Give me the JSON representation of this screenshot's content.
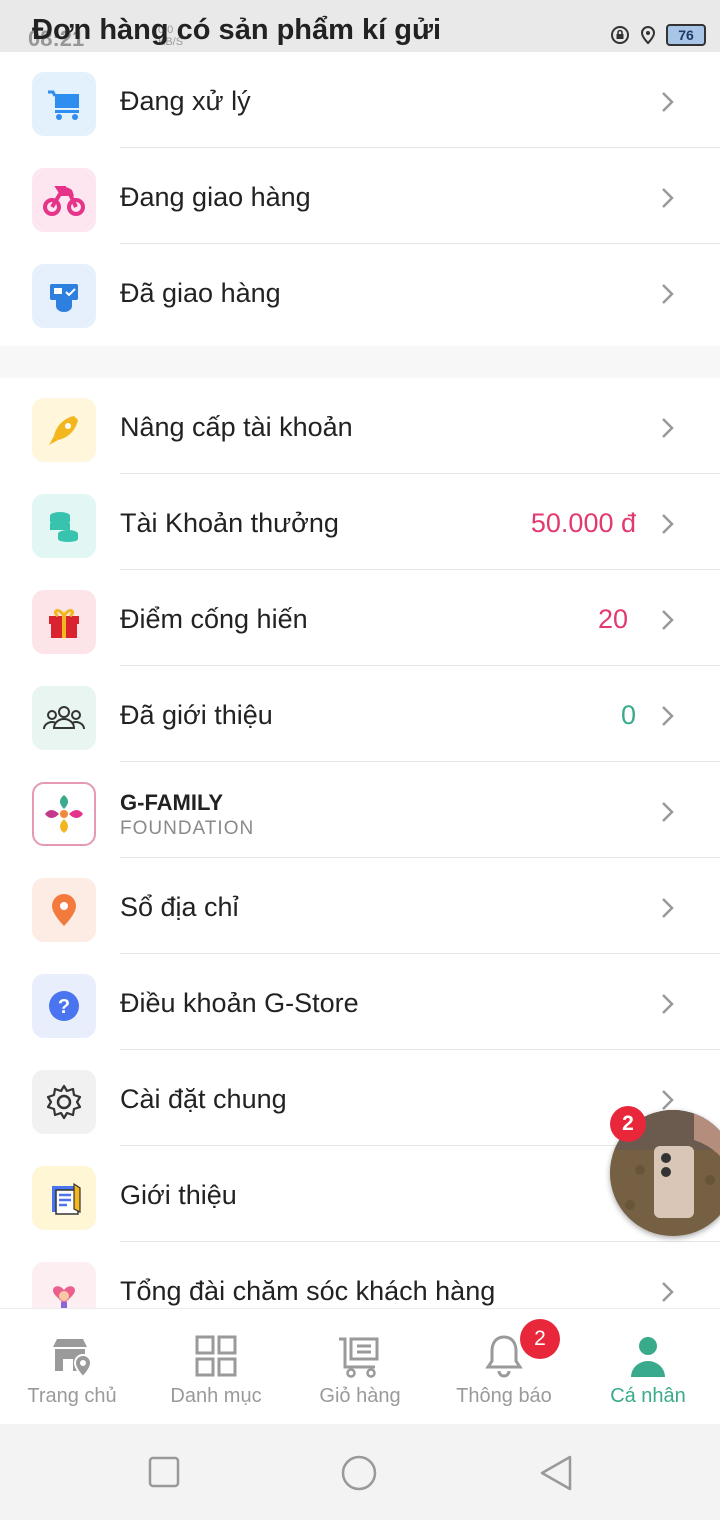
{
  "status_bar": {
    "time": "08:21",
    "net_speed": "0.0",
    "net_unit": "KB/S",
    "battery": "76"
  },
  "header": {
    "title": "Đơn hàng có sản phẩm kí gửi"
  },
  "orders": [
    {
      "label": "Đang xử lý",
      "icon": "cart-icon"
    },
    {
      "label": "Đang giao hàng",
      "icon": "motorbike-icon"
    },
    {
      "label": "Đã giao hàng",
      "icon": "delivered-box-icon"
    }
  ],
  "menu": [
    {
      "label": "Nâng cấp tài khoản",
      "icon": "rocket-icon"
    },
    {
      "label": "Tài Khoản thưởng",
      "icon": "coins-icon",
      "value": "50.000 đ",
      "value_color": "#e23a6e"
    },
    {
      "label": "Điểm cống hiến",
      "icon": "gift-icon",
      "value": "20",
      "value_color": "#e23a6e"
    },
    {
      "label": "Đã giới thiệu",
      "icon": "people-icon",
      "value": "0",
      "value_color": "#3aaa8c"
    },
    {
      "brand_title": "G-FAMILY",
      "brand_sub": "FOUNDATION",
      "icon": "g-family-logo"
    },
    {
      "label": "Sổ địa chỉ",
      "icon": "location-pin-icon"
    },
    {
      "label": "Điều khoản G-Store",
      "icon": "question-icon"
    },
    {
      "label": "Cài đặt chung",
      "icon": "gear-icon"
    },
    {
      "label": "Giới thiệu",
      "icon": "info-document-icon"
    },
    {
      "label": "Tổng đài chăm sóc khách hàng",
      "icon": "customer-care-icon"
    }
  ],
  "bottom_nav": [
    {
      "label": "Trang chủ",
      "icon": "store-location-icon",
      "active": false
    },
    {
      "label": "Danh mục",
      "icon": "grid-icon",
      "active": false
    },
    {
      "label": "Giỏ hàng",
      "icon": "cart-outline-icon",
      "active": false
    },
    {
      "label": "Thông báo",
      "icon": "bell-icon",
      "active": false,
      "badge": "2"
    },
    {
      "label": "Cá nhân",
      "icon": "person-icon",
      "active": true
    }
  ],
  "chat_bubble": {
    "badge": "2"
  },
  "colors": {
    "accent": "#3aaa8c",
    "badge": "#e8283a",
    "money": "#e23a6e"
  }
}
